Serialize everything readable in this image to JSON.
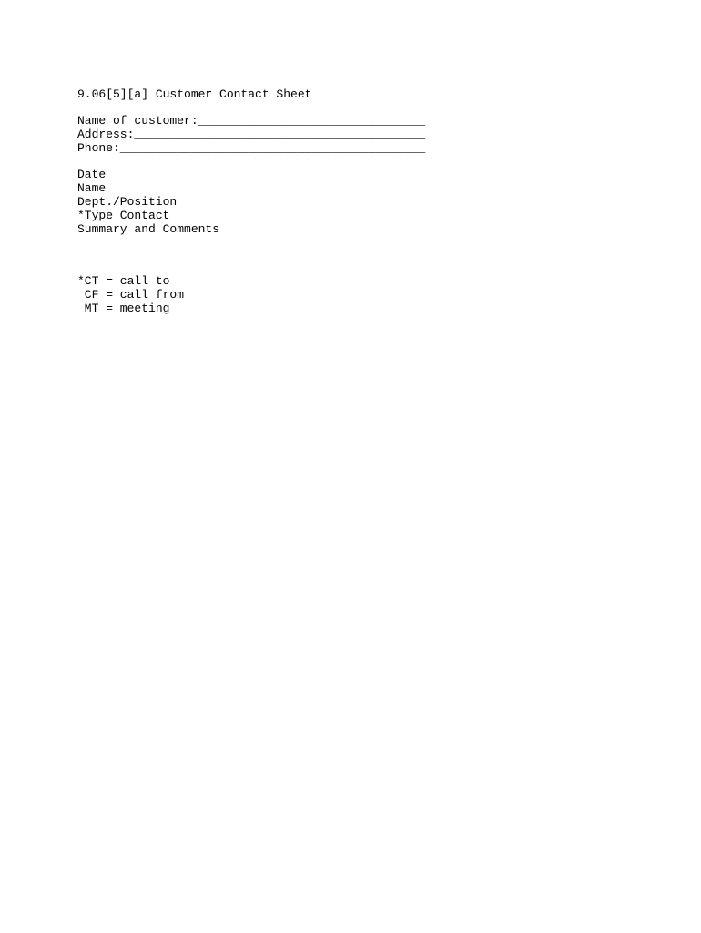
{
  "doc": {
    "title": "9.06[5][a] Customer Contact Sheet",
    "fields": {
      "customer_name": "Name of customer:________________________________",
      "address": "Address:_________________________________________",
      "phone": "Phone:___________________________________________"
    },
    "columns": {
      "date": "Date",
      "name": "Name",
      "dept_position": "Dept./Position",
      "type_contact": "*Type Contact",
      "summary": "Summary and Comments"
    },
    "legend": {
      "ct": "*CT = call to",
      "cf": " CF = call from",
      "mt": " MT = meeting"
    }
  }
}
